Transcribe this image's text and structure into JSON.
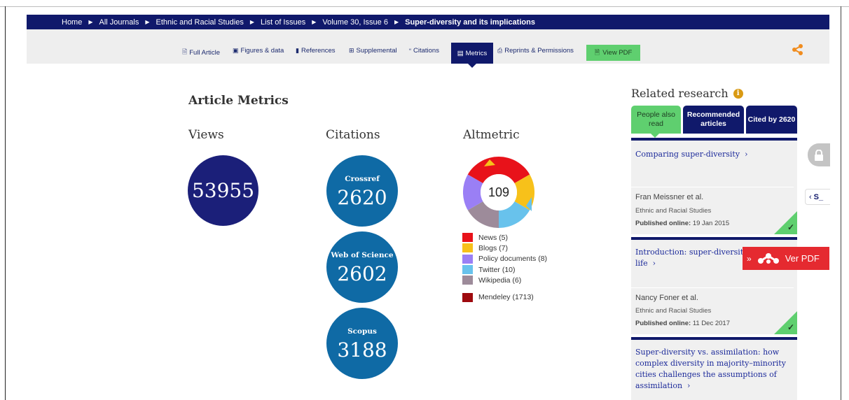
{
  "breadcrumb": [
    "Home",
    "All Journals",
    "Ethnic and Racial Studies",
    "List of Issues",
    "Volume 30, Issue 6",
    "Super-diversity and its implications"
  ],
  "tabs": {
    "full_article": "Full Article",
    "figures": "Figures & data",
    "references": "References",
    "supplemental": "Supplemental",
    "citations": "Citations",
    "metrics": "Metrics",
    "reprints": "Reprints & Permissions",
    "view_pdf": "View PDF"
  },
  "metrics": {
    "title": "Article Metrics",
    "views": {
      "label": "Views",
      "value": "53955"
    },
    "citations": {
      "label": "Citations",
      "items": [
        {
          "source": "Crossref",
          "value": "2620"
        },
        {
          "source": "Web of Science",
          "value": "2602"
        },
        {
          "source": "Scopus",
          "value": "3188"
        }
      ]
    },
    "altmetric": {
      "label": "Altmetric",
      "score": "109",
      "legend": [
        {
          "label": "News (5)",
          "color": "#e8121a"
        },
        {
          "label": "Blogs (7)",
          "color": "#f7c11a"
        },
        {
          "label": "Policy documents (8)",
          "color": "#9a7ff5"
        },
        {
          "label": "Twitter (10)",
          "color": "#68c2ec"
        },
        {
          "label": "Wikipedia (6)",
          "color": "#9d8b9a"
        },
        {
          "label": "Mendeley (1713)",
          "color": "#9e0a0e"
        }
      ]
    }
  },
  "related": {
    "title": "Related research",
    "tabs": [
      "People also read",
      "Recommended articles",
      "Cited by 2620"
    ],
    "cards": [
      {
        "title": "Comparing super-diversity",
        "authors": "Fran Meissner et al.",
        "journal": "Ethnic and Racial Studies",
        "published_label": "Published online:",
        "published_date": "19 Jan 2015"
      },
      {
        "title_line1": "Introduction: super-diversity",
        "title_line2": "life",
        "authors": "Nancy Foner et al.",
        "journal": "Ethnic and Racial Studies",
        "published_label": "Published online:",
        "published_date": "11 Dec 2017"
      },
      {
        "title_lines": [
          "Super-diversity vs. assimilation: how",
          "complex diversity in majority–minority",
          "cities challenges the assumptions of",
          "assimilation"
        ]
      }
    ]
  },
  "side": {
    "s_label": "S_",
    "ver_pdf": "Ver PDF"
  }
}
